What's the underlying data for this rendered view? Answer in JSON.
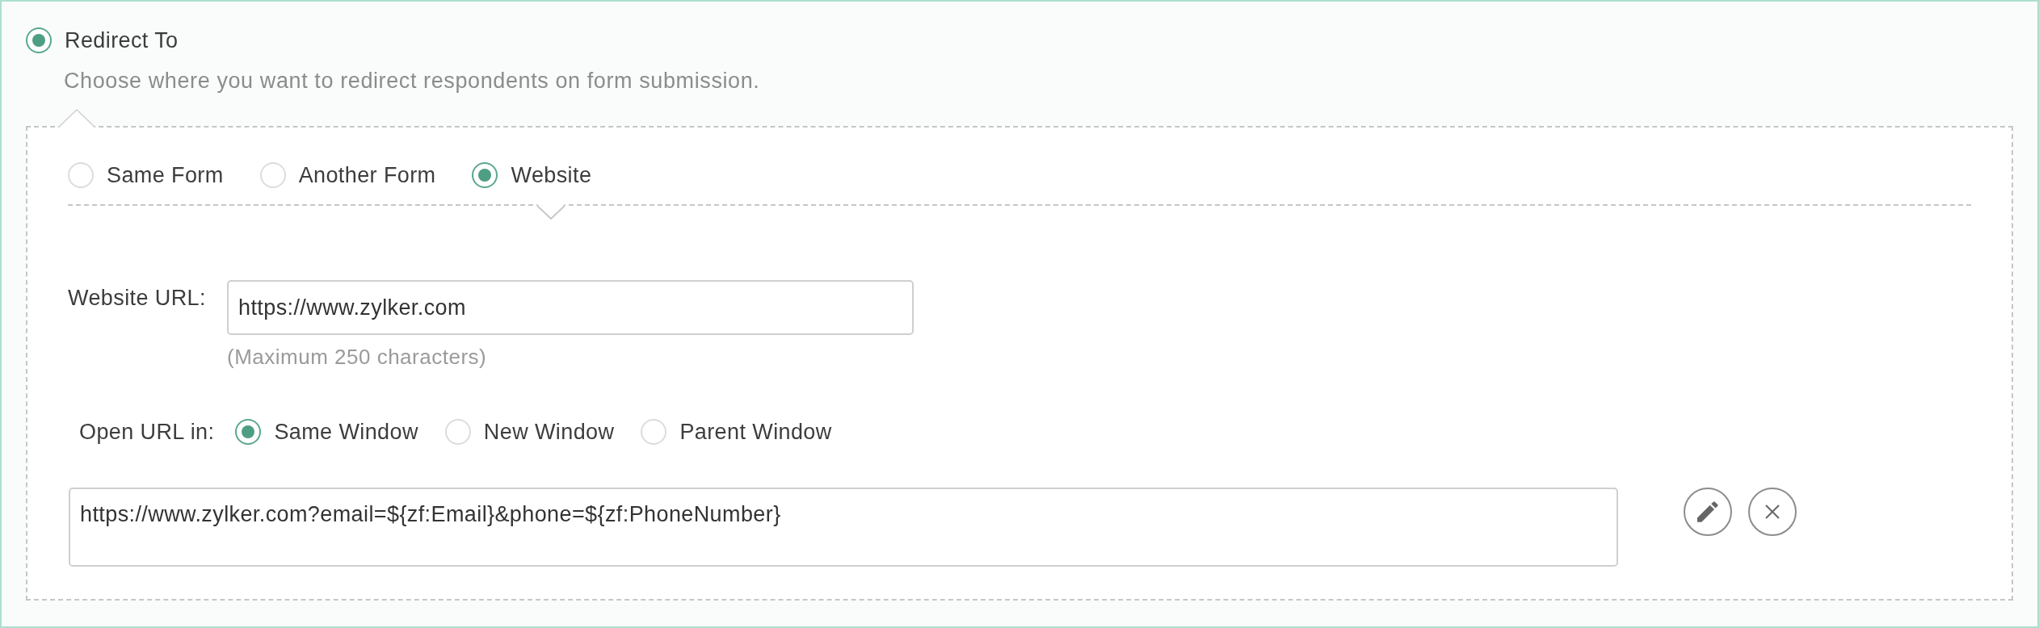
{
  "redirect": {
    "label": "Redirect To",
    "selected": true,
    "description": "Choose where you want to redirect respondents on form submission."
  },
  "destination_options": [
    {
      "label": "Same Form",
      "selected": false
    },
    {
      "label": "Another Form",
      "selected": false
    },
    {
      "label": "Website",
      "selected": true
    }
  ],
  "website_url": {
    "label": "Website URL:",
    "value": "https://www.zylker.com",
    "note": "(Maximum 250 characters)"
  },
  "open_url_in": {
    "label": "Open URL in:",
    "options": [
      {
        "label": "Same Window",
        "selected": true
      },
      {
        "label": "New Window",
        "selected": false
      },
      {
        "label": "Parent Window",
        "selected": false
      }
    ]
  },
  "redirect_url_preview": {
    "value": "https://www.zylker.com?email=${zf:Email}&phone=${zf:PhoneNumber}"
  }
}
